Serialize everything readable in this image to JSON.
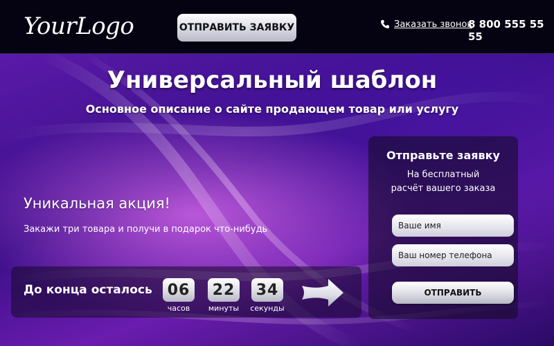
{
  "header": {
    "logo": "YourLogo",
    "cta_label": "ОТПРАВИТЬ ЗАЯВКУ",
    "call_link": "Заказать звонок",
    "phone": "8 800 555 55 55"
  },
  "hero": {
    "title": "Универсальный шаблон",
    "subtitle": "Основное описание о сайте продающем товар или услугу",
    "promo_title": "Уникальная акция!",
    "promo_text": "Закажи три товара и получи в подарок что-нибудь"
  },
  "countdown": {
    "label": "До конца осталось",
    "hours": "06",
    "hours_label": "часов",
    "minutes": "22",
    "minutes_label": "минуты",
    "seconds": "34",
    "seconds_label": "секунды"
  },
  "form": {
    "title": "Отправьте заявку",
    "desc_line1": "На бесплатный",
    "desc_line2": "расчёт вашего заказа",
    "name_placeholder": "Ваше имя",
    "phone_placeholder": "Ваш номер телефона",
    "submit_label": "ОТПРАВИТЬ"
  },
  "icons": {
    "phone": "phone-icon",
    "arrow": "arrow-right-icon"
  }
}
